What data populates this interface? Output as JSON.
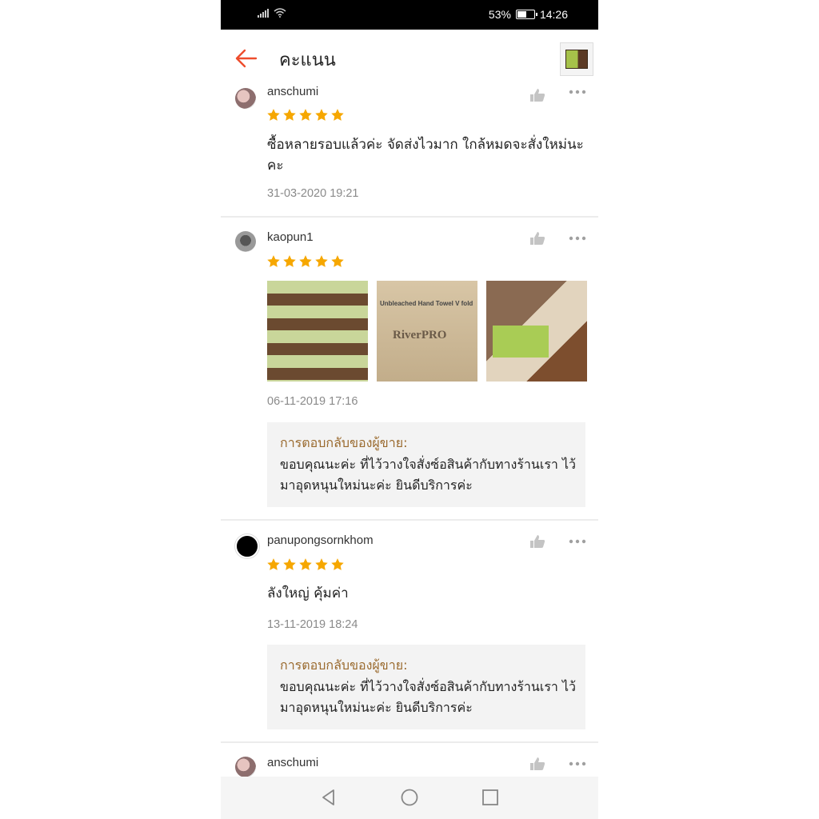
{
  "status_bar": {
    "battery": "53%",
    "battery_level": 0.53,
    "time": "14:26"
  },
  "header": {
    "title": "คะแนน",
    "back_icon": "back-arrow-icon",
    "accent": "#ee4d2d"
  },
  "reviews": [
    {
      "username": "anschumi",
      "stars": 5,
      "text": "ซื้อหลายรอบแล้วค่ะ จัดส่งไวมาก ใกล้หมดจะสั่งใหม่นะคะ",
      "date": "31-03-2020 19:21"
    },
    {
      "username": "kaopun1",
      "stars": 5,
      "photos": [
        {
          "label": ""
        },
        {
          "label": "Unbleached Hand Towel V fold",
          "brand": "RiverPRO"
        },
        {
          "label": ""
        }
      ],
      "date": "06-11-2019 17:16",
      "seller_reply": {
        "label": "การตอบกลับของผู้ขาย:",
        "text": "ขอบคุณนะค่ะ ที่ไว้วางใจสั่งซ์อสินค้ากับทางร้านเรา ไว้มาอุดหนุนใหม่นะค่ะ ยินดีบริการค่ะ"
      }
    },
    {
      "username": "panupongsornkhom",
      "stars": 5,
      "text": "ลังใหญ่ คุ้มค่า",
      "date": "13-11-2019 18:24",
      "seller_reply": {
        "label": "การตอบกลับของผู้ขาย:",
        "text": "ขอบคุณนะค่ะ ที่ไว้วางใจสั่งซ์อสินค้ากับทางร้านเรา ไว้มาอุดหนุนใหม่นะค่ะ ยินดีบริการค่ะ"
      }
    },
    {
      "username": "anschumi"
    }
  ],
  "colors": {
    "star": "#f6a700",
    "reply_label": "#9a6a2e",
    "date": "#8a8a8a"
  }
}
